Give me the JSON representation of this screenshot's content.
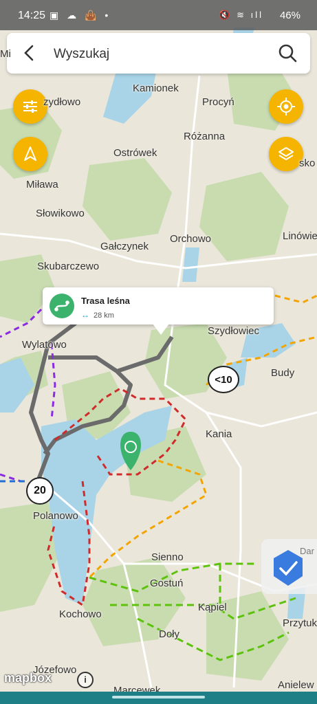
{
  "status": {
    "time": "14:25",
    "left_icons": "▣ ☁ 👜 •",
    "right_icons": "🔇 ≋ ıll",
    "battery": "46%"
  },
  "search": {
    "placeholder": "Wyszukaj"
  },
  "popup": {
    "title": "Trasa leśna",
    "distance": "28 km"
  },
  "badges": {
    "speed_a": "<10",
    "speed_b": "20"
  },
  "places": {
    "kamionek": "Kamionek",
    "procyn": "Procyń",
    "zydlowo": "zydłowo",
    "rozanna": "Różanna",
    "ostrowek": "Ostrówek",
    "milawa": "Miława",
    "slowikowo": "Słowikowo",
    "orchowo": "Orchowo",
    "galczynek": "Gałczynek",
    "skubarczewo": "Skubarczewo",
    "linowie": "Linówie",
    "wylatowo": "Wylatowo",
    "szydlowiec": "Szydłowiec",
    "budy": "Budy",
    "kania": "Kania",
    "polanowo": "Polanowo",
    "sienno": "Sienno",
    "gostun": "Gostuń",
    "kapiel": "Kąpiel",
    "kochowo": "Kochowo",
    "doly": "Doły",
    "przytuk": "Przytuk",
    "jozefowo": "Józefowo",
    "anielew": "Anielew",
    "marcewek": "Marcewek",
    "sko": "sko",
    "mi": "Mi",
    "dar": "Dar"
  },
  "attribution": {
    "logo": "mapbox",
    "info": "i"
  },
  "colors": {
    "accent": "#f4b400",
    "route_green": "#3bb36d",
    "water": "#a9d4e8",
    "forest": "#c8dcb0",
    "land": "#eae6da"
  }
}
